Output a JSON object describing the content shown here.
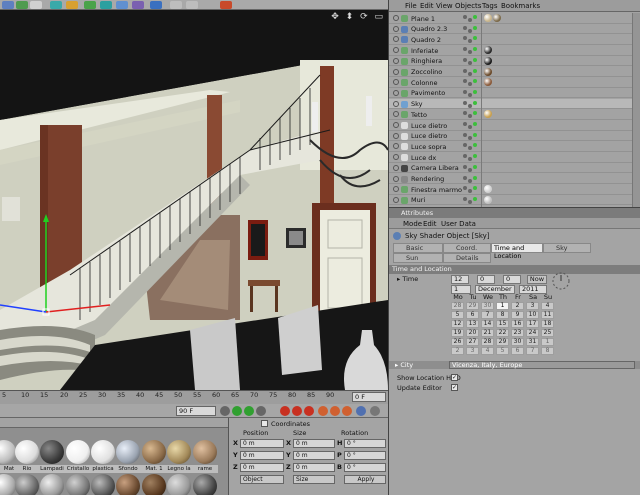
{
  "object_manager": {
    "menu": [
      "File",
      "Edit",
      "View",
      "Objects",
      "Tags",
      "Bookmarks"
    ],
    "objects": [
      {
        "name": "Plane 1",
        "tag_colors": [
          "#c8b48a",
          "#7c6a4a"
        ]
      },
      {
        "name": "Quadro 2.3",
        "tag_colors": []
      },
      {
        "name": "Quadro 2",
        "tag_colors": []
      },
      {
        "name": "Inferiate",
        "tag_colors": [
          "#2a2a2a"
        ]
      },
      {
        "name": "Ringhiera",
        "tag_colors": [
          "#1a1a1a"
        ]
      },
      {
        "name": "Zoccolino",
        "tag_colors": [
          "#6b4a2a"
        ]
      },
      {
        "name": "Colonne",
        "tag_colors": [
          "#8a5a3a"
        ]
      },
      {
        "name": "Pavimento",
        "tag_colors": []
      },
      {
        "name": "Sky",
        "tag_colors": []
      },
      {
        "name": "Tetto",
        "tag_colors": [
          "#c8a050"
        ]
      },
      {
        "name": "Luce dietro",
        "tag_colors": []
      },
      {
        "name": "Luce dietro",
        "tag_colors": []
      },
      {
        "name": "Luce sopra",
        "tag_colors": []
      },
      {
        "name": "Luce dx",
        "tag_colors": []
      },
      {
        "name": "Camera Libera",
        "tag_colors": []
      },
      {
        "name": "Rendering",
        "tag_colors": []
      },
      {
        "name": "Finestra marmo",
        "tag_colors": [
          "#d0d0d0"
        ]
      },
      {
        "name": "Muri",
        "tag_colors": [
          "#c0c0c0"
        ]
      }
    ]
  },
  "attributes": {
    "title": "Attributes",
    "menu": [
      "Mode",
      "Edit",
      "User Data"
    ],
    "object_label": "Sky Shader Object [Sky]",
    "tabs_row1": [
      "Basic",
      "Coord.",
      "Time and Location",
      "Sky"
    ],
    "tabs_row2": [
      "Sun",
      "Details"
    ],
    "active_tab": "Time and Location",
    "section": "Time and Location",
    "time_label": "Time",
    "hour": "12",
    "minute": "0",
    "second": "0",
    "now_button": "Now",
    "day": "1",
    "month": "December",
    "year": "2011",
    "calendar_headers": [
      "Mo",
      "Tu",
      "We",
      "Th",
      "Fr",
      "Sa",
      "Su"
    ],
    "calendar_rows": [
      [
        "28",
        "29",
        "30",
        "1",
        "2",
        "3",
        "4"
      ],
      [
        "5",
        "6",
        "7",
        "8",
        "9",
        "10",
        "11"
      ],
      [
        "12",
        "13",
        "14",
        "15",
        "16",
        "17",
        "18"
      ],
      [
        "19",
        "20",
        "21",
        "22",
        "23",
        "24",
        "25"
      ],
      [
        "26",
        "27",
        "28",
        "29",
        "30",
        "31",
        "1"
      ],
      [
        "2",
        "3",
        "4",
        "5",
        "6",
        "7",
        "8"
      ]
    ],
    "city_label": "City",
    "city_value": "Vicenza, Italy, Europe",
    "show_hud_label": "Show Location HUD",
    "update_editor_label": "Update Editor",
    "checkmark": "✓"
  },
  "timeline": {
    "ticks": [
      "5",
      "10",
      "15",
      "20",
      "25",
      "30",
      "35",
      "40",
      "45",
      "50",
      "55",
      "60",
      "65",
      "70",
      "75",
      "80",
      "85",
      "90"
    ],
    "end_frame": "0 F",
    "current_frame": "90 F"
  },
  "materials": {
    "items": [
      {
        "label": "Mat",
        "color": "#bdbdbd"
      },
      {
        "label": "Rio",
        "color": "#dcdcdc"
      },
      {
        "label": "Lampadi",
        "color": "#3a3a3a"
      },
      {
        "label": "Cristallo",
        "color": "#efefef"
      },
      {
        "label": "plastica",
        "color": "#e0e0e0"
      },
      {
        "label": "Sfondo",
        "color": "#9aa3b0"
      },
      {
        "label": "Mat. 1",
        "color": "#8a6a48"
      },
      {
        "label": "Legno la",
        "color": "#a38a5a"
      },
      {
        "label": "rame",
        "color": "#9a7a5a"
      }
    ]
  },
  "coordinates": {
    "title": "Coordinates",
    "headers": [
      "Position",
      "Size",
      "Rotation"
    ],
    "rows": [
      {
        "axis": "X",
        "pos": "0 m",
        "size": "0 m",
        "rot_axis": "H",
        "rot": "0 °"
      },
      {
        "axis": "Y",
        "pos": "0 m",
        "size": "0 m",
        "rot_axis": "P",
        "rot": "0 °"
      },
      {
        "axis": "Z",
        "pos": "0 m",
        "size": "0 m",
        "rot_axis": "B",
        "rot": "0 °"
      }
    ],
    "mode_select": "Object",
    "size_select": "Size",
    "apply": "Apply"
  }
}
